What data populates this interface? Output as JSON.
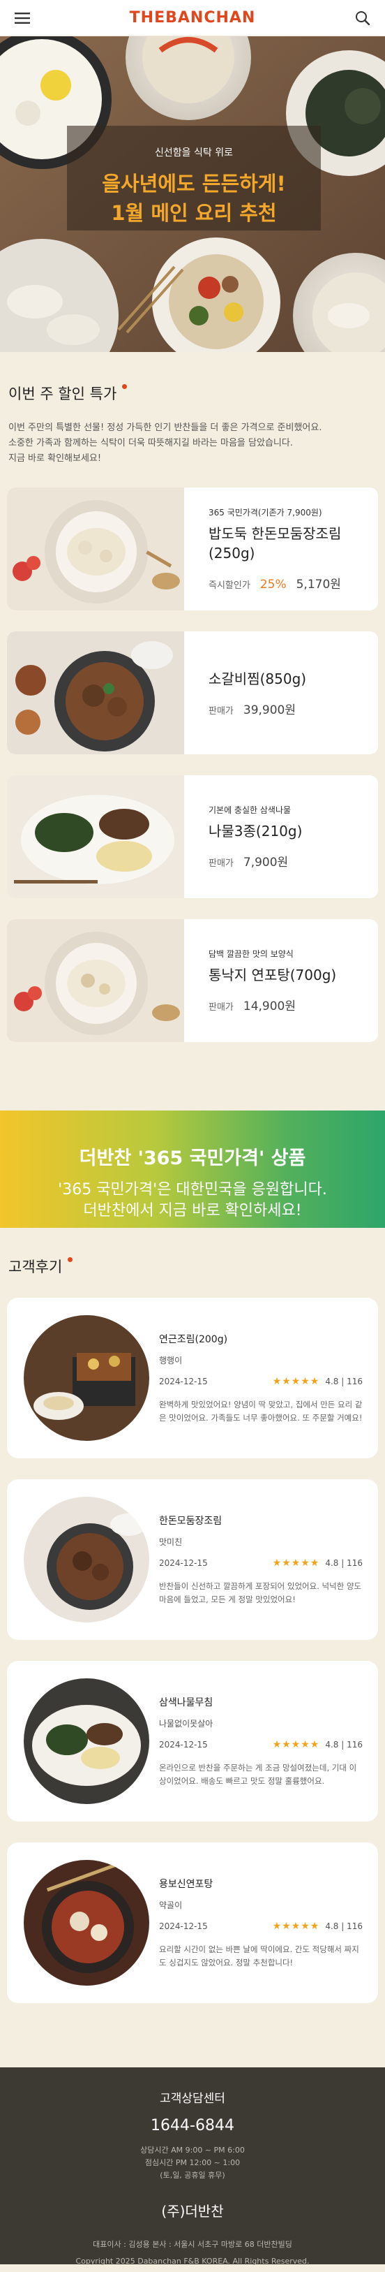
{
  "header": {
    "logo": "THEBANCHAN",
    "menu_icon": "hamburger-menu-icon",
    "search_icon": "search-icon"
  },
  "hero": {
    "subtitle": "신선함을 식탁 위로",
    "title_line1": "을사년에도 든든하게!",
    "title_line2": "1월 메인 요리 추천"
  },
  "deals": {
    "title": "이번 주 할인 특가",
    "description": [
      "이번 주만의 특별한 선물! 정성 가득한 인기 반찬들을 더 좋은 가격으로 준비했어요.",
      "소중한 가족과 함께하는 식탁이 더욱 따뜻해지길 바라는 마음을 담았습니다.",
      "지금 바로 확인해보세요!"
    ],
    "items": [
      {
        "tag": "365 국민가격(기존가 7,900원)",
        "name_line1": "밥도둑 한돈모둠장조림",
        "name_line2": "(250g)",
        "price_label": "즉시할인가",
        "discount": "25%",
        "price": "5,170원"
      },
      {
        "tag": "",
        "name_line1": "소갈비찜(850g)",
        "name_line2": "",
        "price_label": "판매가",
        "discount": "",
        "price": "39,900원"
      },
      {
        "tag": "기본에 충실한 삼색나물",
        "name_line1": "나물3종(210g)",
        "name_line2": "",
        "price_label": "판매가",
        "discount": "",
        "price": "7,900원"
      },
      {
        "tag": "담백 깔끔한 맛의 보양식",
        "name_line1": "통낙지 연포탕(700g)",
        "name_line2": "",
        "price_label": "판매가",
        "discount": "",
        "price": "14,900원"
      }
    ]
  },
  "banner": {
    "title": "더반찬 '365 국민가격' 상품",
    "sub_line1": "'365 국민가격'은 대한민국을 응원합니다.",
    "sub_line2": "더반찬에서 지금 바로 확인하세요!"
  },
  "reviews": {
    "title": "고객후기",
    "items": [
      {
        "name": "연근조림(200g)",
        "user": "행행이",
        "date": "2024-12-15",
        "stars": "★★★★★",
        "score": "4.8 | 116",
        "text": "완벽하게 맛있었어요! 양념이 딱 맞았고, 집에서 만든 요리 같은 맛이었어요. 가족들도 너무 좋아했어요. 또 주문할 거예요!"
      },
      {
        "name": "한돈모둠장조림",
        "user": "맛미친",
        "date": "2024-12-15",
        "stars": "★★★★★",
        "score": "4.8 | 116",
        "text": "반찬들이 신선하고 깔끔하게 포장되어 있었어요. 넉넉한 양도 마음에 들었고, 모든 게 정말 맛있었어요!"
      },
      {
        "name": "삼색나물무침",
        "user": "나물없이못살아",
        "date": "2024-12-15",
        "stars": "★★★★★",
        "score": "4.8 | 116",
        "text": "온라인으로 반찬을 주문하는 게 조금 망설여졌는데, 기대 이상이었어요. 배송도 빠르고 맛도 정말 훌륭했어요."
      },
      {
        "name": "용보신연포탕",
        "user": "약골이",
        "date": "2024-12-15",
        "stars": "★★★★★",
        "score": "4.8 | 116",
        "text": "요리할 시간이 없는 바쁜 날에 딱이에요. 간도 적당해서 짜지도 싱겁지도 않았어요. 정말 추천합니다!"
      }
    ]
  },
  "footer": {
    "cs_title": "고객상담센터",
    "phone": "1644-6844",
    "hours_line1": "상담시간 AM 9:00 ~ PM 6:00",
    "hours_line2": "점심시간 PM 12:00 ~ 1:00",
    "hours_line3": "(토,일, 공휴일 휴무)",
    "company": "(주)더반찬",
    "address": "대표이사 : 김성용 본사 : 서울시 서초구 마방로 68 더반찬빌딩",
    "copyright": "Copyright 2025 Dabanchan F&B KOREA. All Rights Reserved."
  },
  "colors": {
    "brand": "#e2461c",
    "hero_title": "#f3a82b",
    "discount": "#f07a1e",
    "star": "#f2a31b",
    "page_bg": "#f4eee1",
    "footer_bg": "#3d3a34"
  }
}
